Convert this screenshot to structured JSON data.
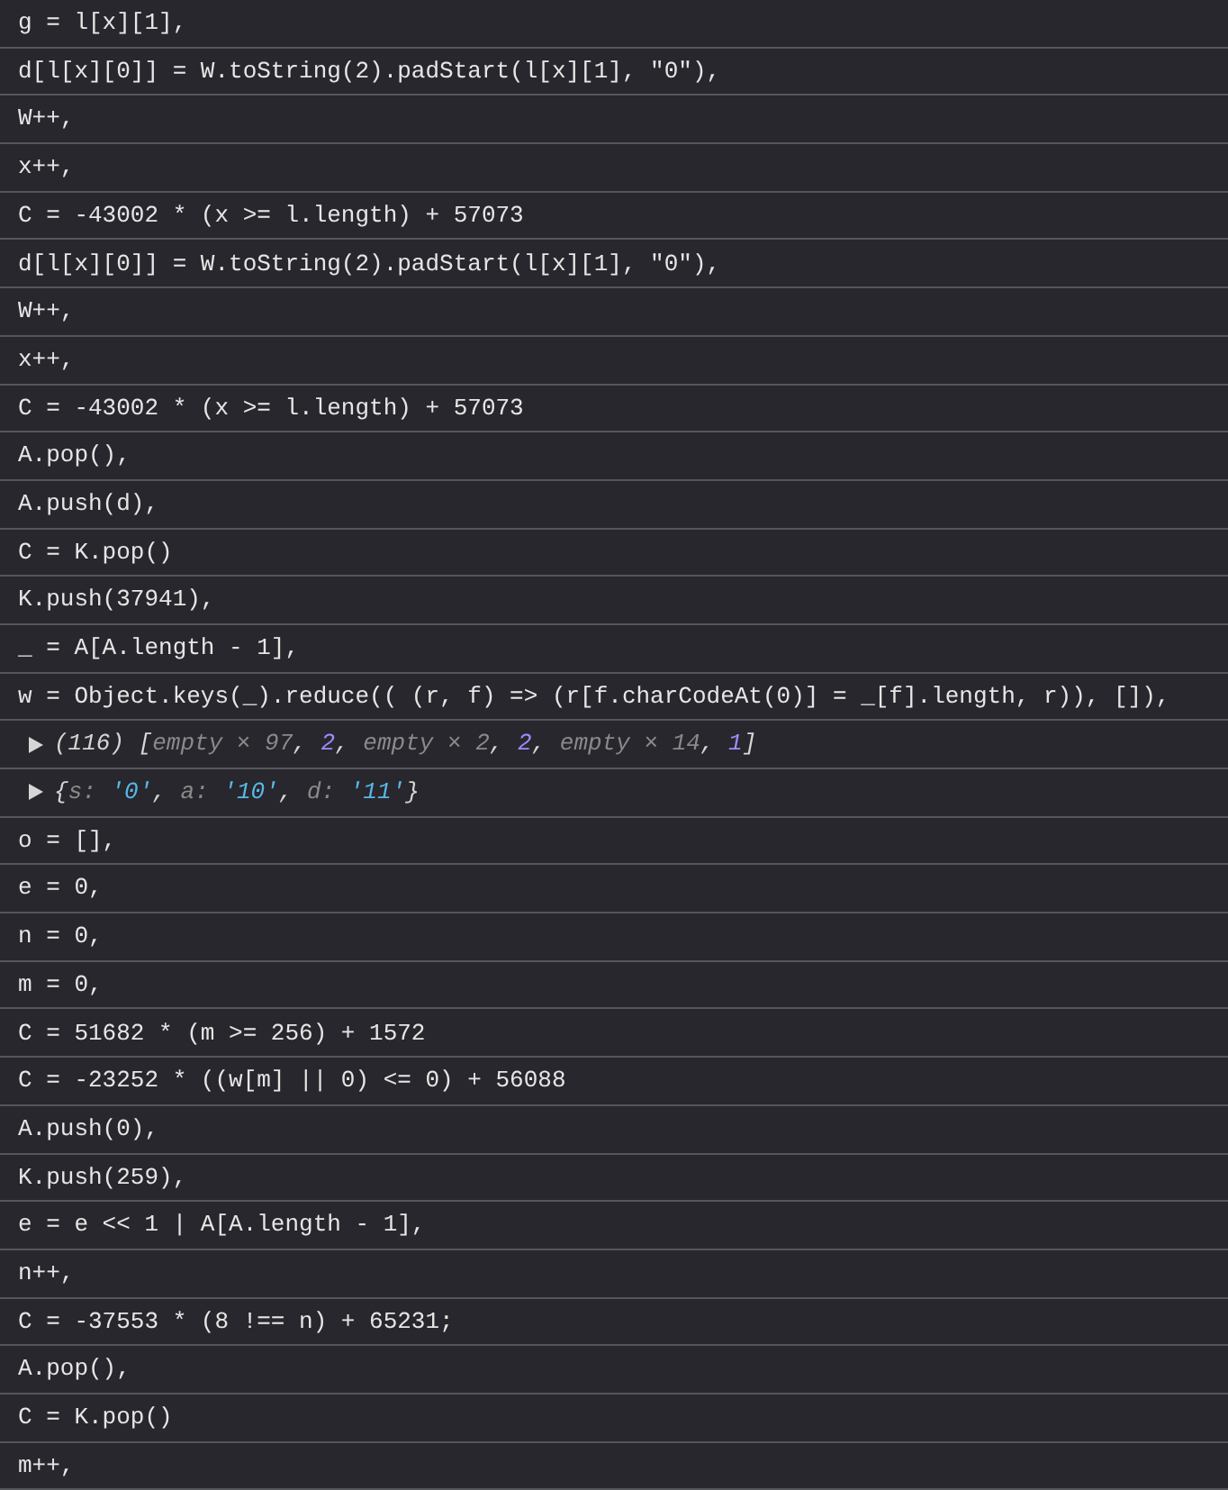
{
  "console_rows": [
    {
      "kind": "code",
      "text": "g = l[x][1],"
    },
    {
      "kind": "code",
      "text": "d[l[x][0]] = W.toString(2).padStart(l[x][1], \"0\"),"
    },
    {
      "kind": "code",
      "text": "W++,"
    },
    {
      "kind": "code",
      "text": "x++,"
    },
    {
      "kind": "code",
      "text": "C = -43002 * (x >= l.length) + 57073"
    },
    {
      "kind": "code",
      "text": "d[l[x][0]] = W.toString(2).padStart(l[x][1], \"0\"),"
    },
    {
      "kind": "code",
      "text": "W++,"
    },
    {
      "kind": "code",
      "text": "x++,"
    },
    {
      "kind": "code",
      "text": "C = -43002 * (x >= l.length) + 57073"
    },
    {
      "kind": "code",
      "text": "A.pop(),"
    },
    {
      "kind": "code",
      "text": "A.push(d),"
    },
    {
      "kind": "code",
      "text": "C = K.pop()"
    },
    {
      "kind": "code",
      "text": "K.push(37941),"
    },
    {
      "kind": "code",
      "text": "_ = A[A.length - 1],"
    },
    {
      "kind": "code",
      "text": "w = Object.keys(_).reduce(( (r, f) => (r[f.charCodeAt(0)] = _[f].length, r)), []),"
    },
    {
      "kind": "preview",
      "expanded": false,
      "tokens": [
        {
          "kind": "plain",
          "text": "(116) "
        },
        {
          "kind": "plain",
          "text": "["
        },
        {
          "kind": "dim",
          "text": "empty × 97"
        },
        {
          "kind": "plain",
          "text": ", "
        },
        {
          "kind": "number",
          "text": "2"
        },
        {
          "kind": "plain",
          "text": ", "
        },
        {
          "kind": "dim",
          "text": "empty × 2"
        },
        {
          "kind": "plain",
          "text": ", "
        },
        {
          "kind": "number",
          "text": "2"
        },
        {
          "kind": "plain",
          "text": ", "
        },
        {
          "kind": "dim",
          "text": "empty × 14"
        },
        {
          "kind": "plain",
          "text": ", "
        },
        {
          "kind": "number",
          "text": "1"
        },
        {
          "kind": "plain",
          "text": "]"
        }
      ]
    },
    {
      "kind": "preview",
      "expanded": false,
      "tokens": [
        {
          "kind": "plain",
          "text": "{"
        },
        {
          "kind": "dim",
          "text": "s: "
        },
        {
          "kind": "string",
          "text": "'0'"
        },
        {
          "kind": "plain",
          "text": ", "
        },
        {
          "kind": "dim",
          "text": "a: "
        },
        {
          "kind": "string",
          "text": "'10'"
        },
        {
          "kind": "plain",
          "text": ", "
        },
        {
          "kind": "dim",
          "text": "d: "
        },
        {
          "kind": "string",
          "text": "'11'"
        },
        {
          "kind": "plain",
          "text": "}"
        }
      ]
    },
    {
      "kind": "code",
      "text": "o = [],"
    },
    {
      "kind": "code",
      "text": "e = 0,"
    },
    {
      "kind": "code",
      "text": "n = 0,"
    },
    {
      "kind": "code",
      "text": "m = 0,"
    },
    {
      "kind": "code",
      "text": "C = 51682 * (m >= 256) + 1572"
    },
    {
      "kind": "code",
      "text": "C = -23252 * ((w[m] || 0) <= 0) + 56088"
    },
    {
      "kind": "code",
      "text": "A.push(0),"
    },
    {
      "kind": "code",
      "text": "K.push(259),"
    },
    {
      "kind": "code",
      "text": "e = e << 1 | A[A.length - 1],"
    },
    {
      "kind": "code",
      "text": "n++,"
    },
    {
      "kind": "code",
      "text": "C = -37553 * (8 !== n) + 65231;"
    },
    {
      "kind": "code",
      "text": "A.pop(),"
    },
    {
      "kind": "code",
      "text": "C = K.pop()"
    },
    {
      "kind": "code",
      "text": "m++,"
    }
  ]
}
